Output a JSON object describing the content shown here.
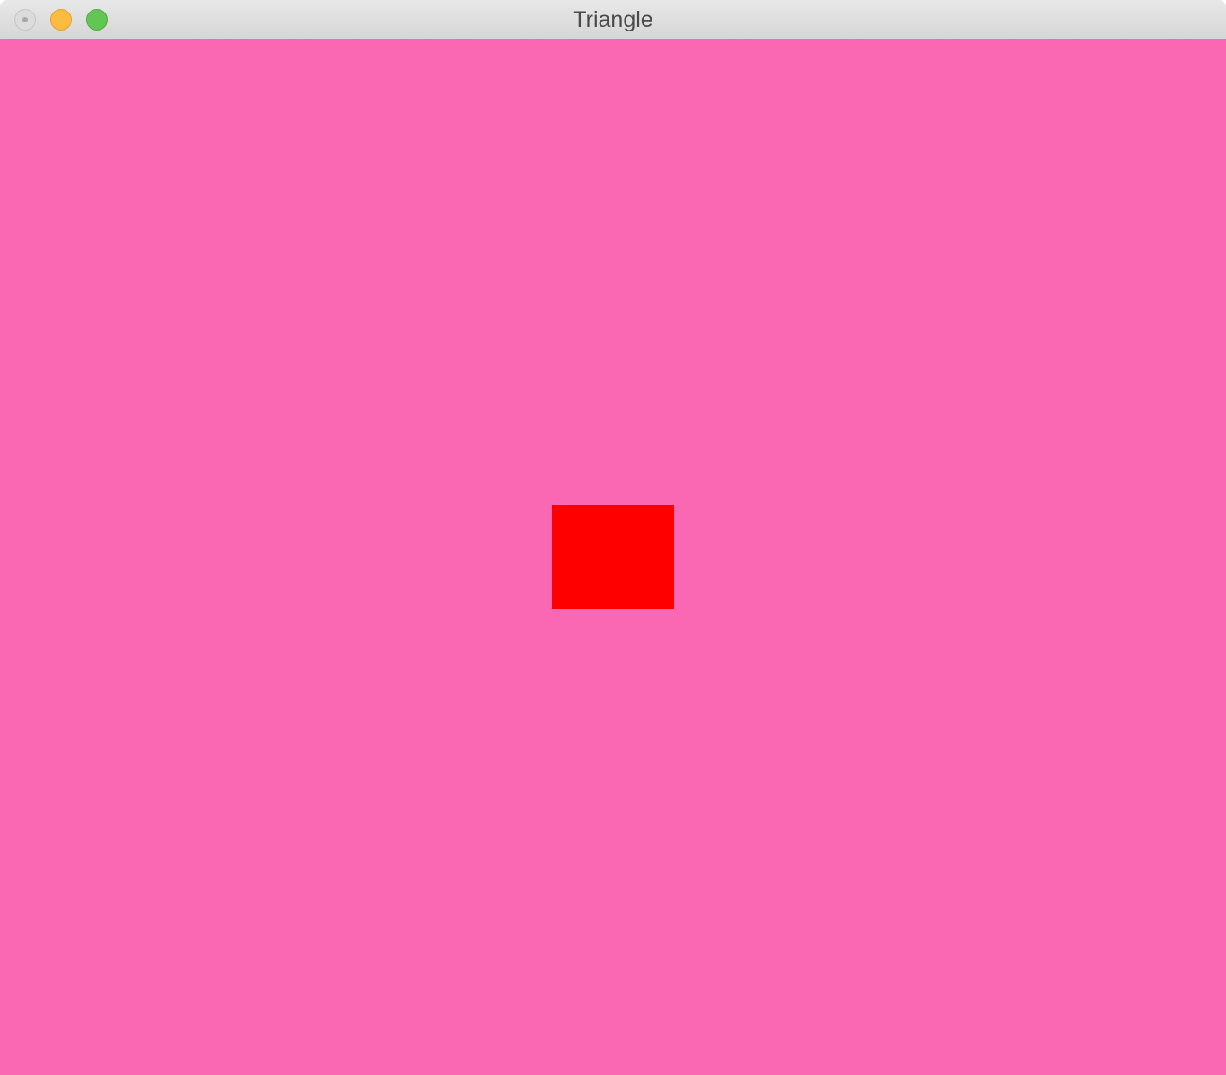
{
  "window": {
    "title": "Triangle"
  },
  "titlebar": {
    "buttons": [
      {
        "name": "close",
        "icon": "close-icon",
        "color": "#dcdcdc"
      },
      {
        "name": "minimize",
        "icon": "minimize-icon",
        "color": "#fdbc40"
      },
      {
        "name": "maximize",
        "icon": "maximize-icon",
        "color": "#62c655"
      }
    ]
  },
  "canvas": {
    "background_color": "#fa67b3",
    "shape_color": "#ff0000"
  }
}
